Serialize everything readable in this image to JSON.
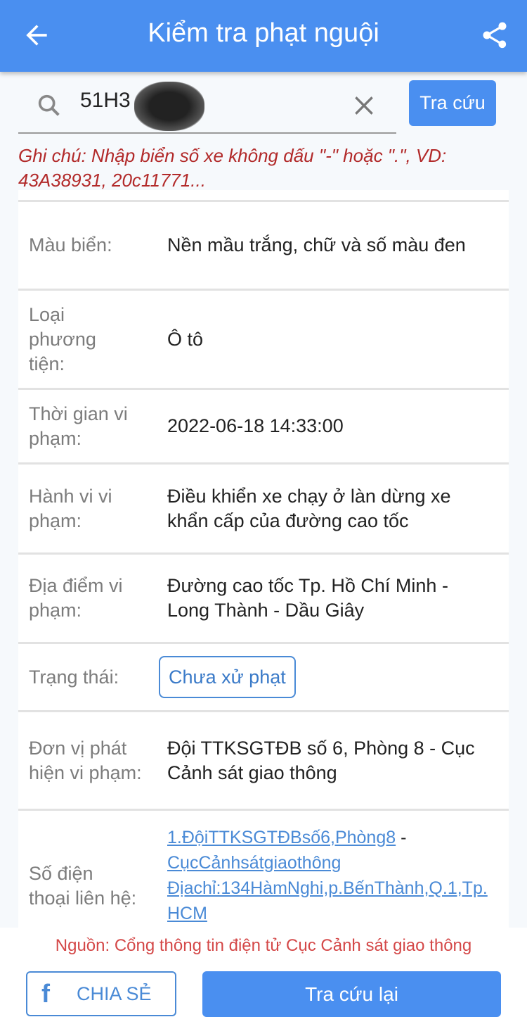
{
  "header": {
    "title": "Kiểm tra phạt nguội",
    "back_icon": "arrow-left-icon",
    "share_icon": "share-icon"
  },
  "search": {
    "value": "51H3",
    "placeholder": "",
    "button_label": "Tra cứu"
  },
  "note": "Ghi chú: Nhập biển số xe không dấu \"-\" hoặc \".\", VD: 43A38931, 20c11771...",
  "rows": [
    {
      "label": "Màu biển:",
      "value": "Nền mầu trắng, chữ và số màu đen"
    },
    {
      "label": "Loại phương tiện:",
      "value": "Ô tô"
    },
    {
      "label": "Thời gian vi phạm:",
      "value": "2022-06-18 14:33:00"
    },
    {
      "label": "Hành vi vi phạm:",
      "value": "Điều khiển xe chạy ở làn dừng xe khẩn cấp của đường cao tốc"
    },
    {
      "label": "Địa điểm vi phạm:",
      "value": "Đường cao tốc Tp. Hồ Chí Minh - Long Thành - Dầu Giây"
    },
    {
      "label": "Trạng thái:",
      "value": "Chưa xử phạt"
    },
    {
      "label": "Đơn vị phát hiện vi phạm:",
      "value": "Đội TTKSGTĐB số 6, Phòng 8 - Cục Cảnh sát giao thông"
    },
    {
      "label": "Số điện thoại liên hệ:",
      "link1": "1.ĐộiTTKSGTĐBsố6,Phòng8",
      "sep": " -",
      "link2": "CụcCảnhsátgiaothông",
      "link3": "Địachỉ:134HàmNghi,p.BếnThành,Q.1,Tp.HCM"
    }
  ],
  "footer": {
    "source": "Nguồn: Cổng thông tin điện tử Cục Cảnh sát giao thông",
    "share_label": "CHIA SẺ",
    "retry_label": "Tra cứu lại",
    "facebook_icon": "facebook-icon"
  }
}
